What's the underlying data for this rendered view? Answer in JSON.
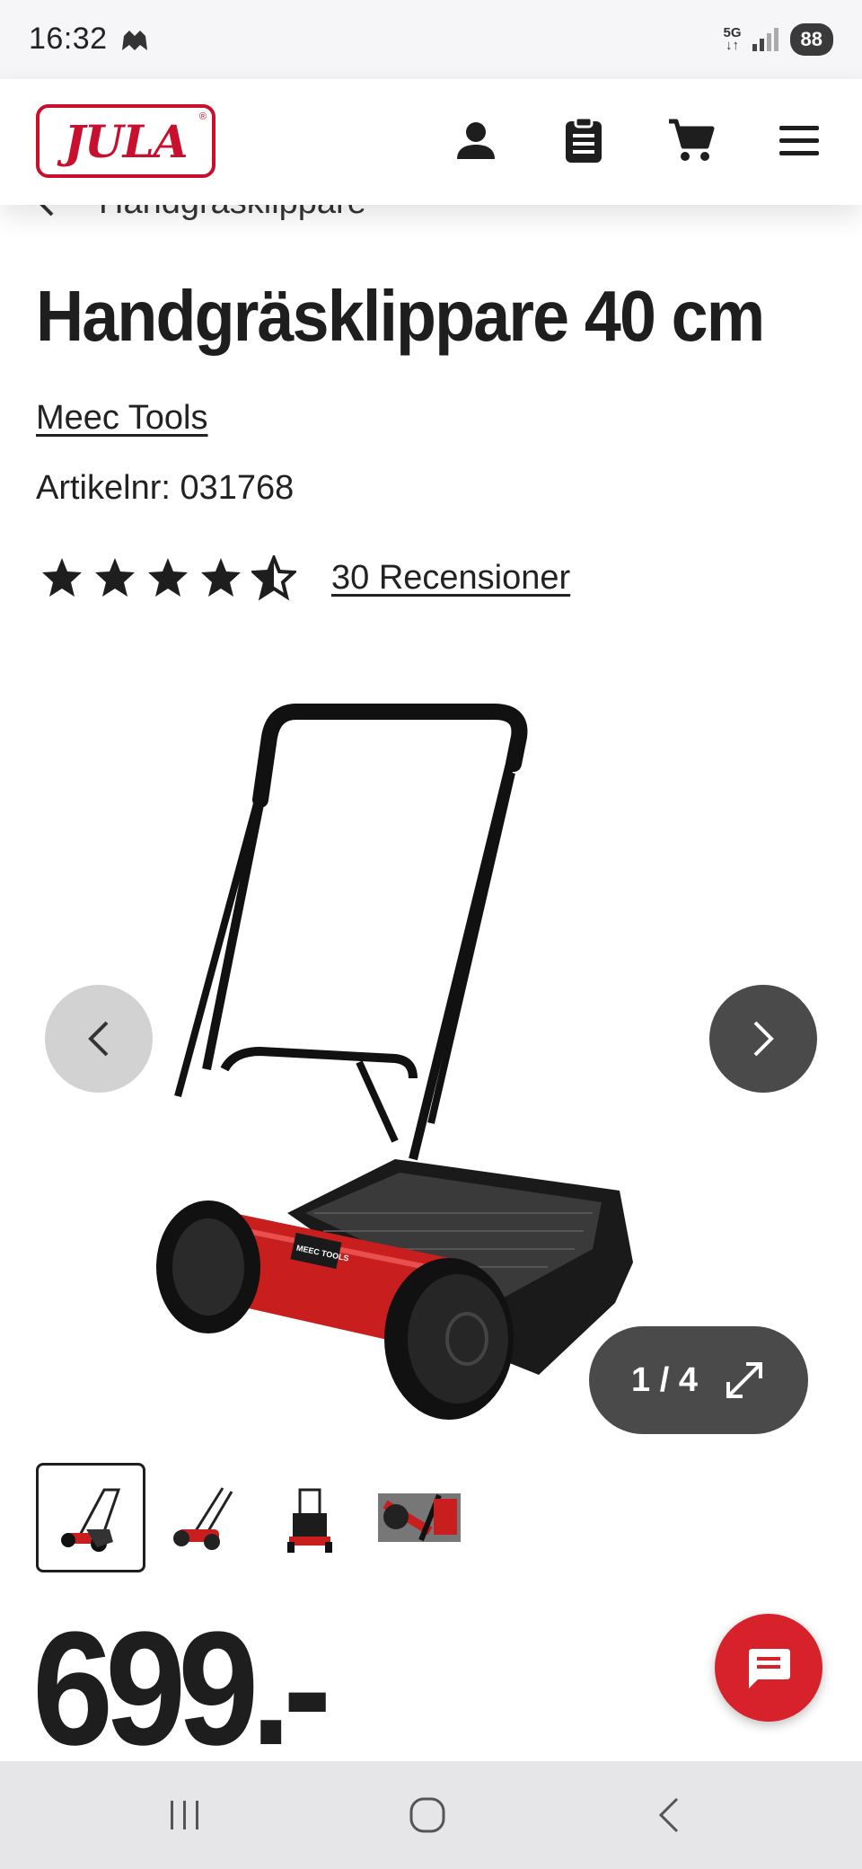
{
  "status_bar": {
    "time": "16:32",
    "network_label": "5G",
    "battery": "88"
  },
  "header": {
    "logo_text": "JULA",
    "logo_registered": "®",
    "icons": [
      "account-icon",
      "shopping-list-icon",
      "cart-icon",
      "menu-icon"
    ]
  },
  "breadcrumb": {
    "label": "Handgräsklippare"
  },
  "product": {
    "title": "Handgräsklippare 40 cm",
    "brand": "Meec Tools",
    "article_number": "Artikelnr: 031768",
    "rating": 4.5,
    "rating_max": 5,
    "reviews_label": "30 Recensioner",
    "price": "699.-"
  },
  "gallery": {
    "counter": "1 / 4",
    "current": 1,
    "total": 4,
    "product_logo_text": "MEEC TOOLS"
  },
  "colors": {
    "brand_red": "#c8102e",
    "chat_red": "#d8222b",
    "dark_button": "#4a4a4a",
    "light_button": "#d2d2d2",
    "text": "#1e1e1e"
  }
}
